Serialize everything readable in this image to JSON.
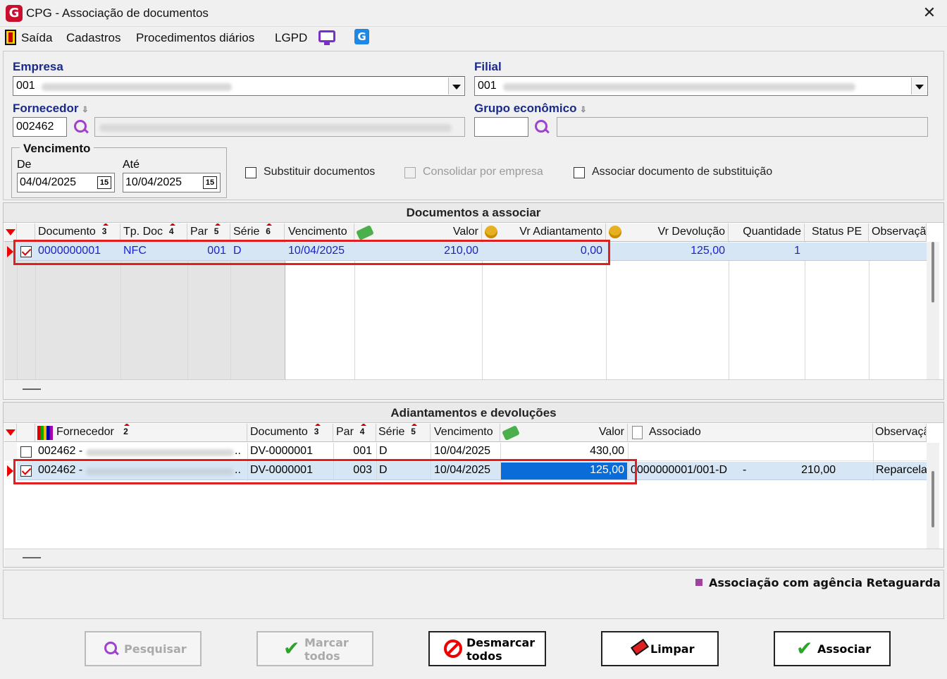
{
  "window": {
    "title": "CPG - Associação de documentos",
    "logo_letter": "G",
    "close_glyph": "✕"
  },
  "menu": {
    "items": [
      "Saída",
      "Cadastros",
      "Procedimentos diários",
      "LGPD"
    ],
    "g_icon_letter": "G"
  },
  "filters": {
    "empresa_label": "Empresa",
    "empresa_code": "001",
    "filial_label": "Filial",
    "filial_code": "001",
    "fornecedor_label": "Fornecedor",
    "fornecedor_code": "002462",
    "grupo_label": "Grupo econômico",
    "grupo_code": "",
    "vencimento_title": "Vencimento",
    "de_label": "De",
    "de_value": "04/04/2025",
    "ate_label": "Até",
    "ate_value": "10/04/2025",
    "cal_glyph": "15",
    "substituir_label": "Substituir documentos",
    "consolidar_label": "Consolidar por empresa",
    "associar_sub_label": "Associar documento de substituição"
  },
  "docs_grid": {
    "title": "Documentos a associar",
    "headers": {
      "documento": "Documento",
      "documento_sort": "3",
      "tp_doc": "Tp. Doc",
      "tp_doc_sort": "4",
      "par": "Par",
      "par_sort": "5",
      "serie": "Série",
      "serie_sort": "6",
      "vencimento": "Vencimento",
      "valor": "Valor",
      "vr_adiantamento": "Vr Adiantamento",
      "vr_devolucao": "Vr Devolução",
      "quantidade": "Quantidade",
      "status_pe": "Status PE",
      "observacao": "Observaçã"
    },
    "row": {
      "checked": true,
      "documento": "0000000001",
      "tp_doc": "NFC",
      "par": "001",
      "serie": "D",
      "vencimento": "10/04/2025",
      "valor": "210,00",
      "vr_adiantamento": "0,00",
      "vr_devolucao": "125,00",
      "quantidade": "1",
      "status_pe": "",
      "observacao": ""
    }
  },
  "adiant_grid": {
    "title": "Adiantamentos e devoluções",
    "headers": {
      "fornecedor": "Fornecedor",
      "fornecedor_sort": "2",
      "documento": "Documento",
      "documento_sort": "3",
      "par": "Par",
      "par_sort": "4",
      "serie": "Série",
      "serie_sort": "5",
      "vencimento": "Vencimento",
      "valor": "Valor",
      "associado": "Associado",
      "observacao": "Observaçã"
    },
    "rows": [
      {
        "checked": false,
        "fornecedor": "002462 -",
        "ellipsis": "..",
        "documento": "DV-0000001",
        "par": "001",
        "serie": "D",
        "vencimento": "10/04/2025",
        "valor": "430,00",
        "associado": "",
        "assoc_valor": "",
        "observacao": ""
      },
      {
        "checked": true,
        "fornecedor": "002462 -",
        "ellipsis": "..",
        "documento": "DV-0000001",
        "par": "003",
        "serie": "D",
        "vencimento": "10/04/2025",
        "valor": "125,00",
        "associado": "0000000001/001-D",
        "assoc_dash": "-",
        "assoc_valor": "210,00",
        "observacao": "Reparcela"
      }
    ]
  },
  "legend": {
    "text": "Associação com agência Retaguarda",
    "color": "#a040a0"
  },
  "buttons": {
    "pesquisar": "Pesquisar",
    "marcar_1": "Marcar",
    "marcar_2": "todos",
    "desmarcar_1": "Desmarcar",
    "desmarcar_2": "todos",
    "limpar": "Limpar",
    "associar": "Associar"
  },
  "colors": {
    "accent_blue": "#1a2a8c",
    "highlight_red": "#e02020",
    "selected_cell": "#0a6cd8"
  }
}
